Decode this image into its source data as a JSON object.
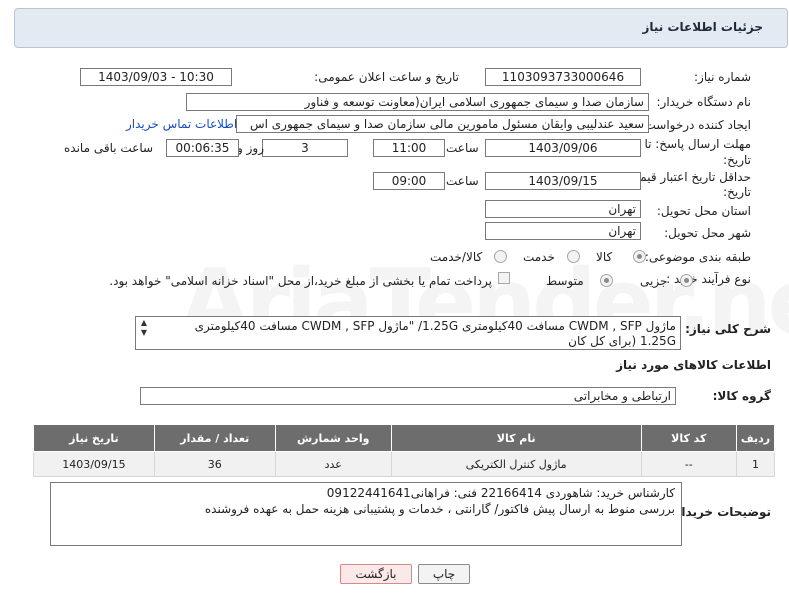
{
  "header": {
    "title": "جزئیات اطلاعات نیاز"
  },
  "fields": {
    "need_number_label": "شماره نیاز:",
    "need_number": "1103093733000646",
    "announce_label": "تاریخ و ساعت اعلان عمومی:",
    "announce_value": "1403/09/03 - 10:30",
    "buyer_org_label": "نام دستگاه خریدار:",
    "buyer_org": "سازمان صدا و سیمای جمهوری اسلامی ایران(معاونت توسعه و فناور",
    "creator_label": "ایجاد کننده درخواست:",
    "creator": "سعید عندلیبی وایقان مسئول مامورین مالی  سازمان صدا و سیمای جمهوری اس",
    "contact_link": "اطلاعات تماس خریدار",
    "deadline_label_1": "مهلت ارسال پاسخ: تا",
    "deadline_label_2": "تاریخ:",
    "deadline_date": "1403/09/06",
    "time_label": "ساعت",
    "deadline_time": "11:00",
    "days_value": "3",
    "days_label": "روز و",
    "remaining_time": "00:06:35",
    "remaining_label": "ساعت باقی مانده",
    "validity_label_1": "حداقل تاریخ اعتبار قیمت: تا",
    "validity_label_2": "تاریخ:",
    "validity_date": "1403/09/15",
    "validity_time": "09:00",
    "province_label": "استان محل تحویل:",
    "province": "تهران",
    "city_label": "شهر محل تحویل:",
    "city": "تهران",
    "category_label": "طبقه بندی موضوعی:",
    "category_options": [
      "کالا",
      "خدمت",
      "کالا/خدمت"
    ],
    "process_label": "نوع فرآیند خرید :",
    "process_options": [
      "جزیی",
      "متوسط"
    ],
    "payment_note": "پرداخت تمام یا بخشی از مبلغ خرید،از محل \"اسناد خزانه اسلامی\" خواهد بود."
  },
  "description": {
    "label": "شرح کلی نیاز:",
    "text": "ماژول CWDM , SFP مسافت 40کیلومتری 1.25G/ \"ماژول CWDM , SFP مسافت 40کیلومتری 1.25G (برای کل کان"
  },
  "goods_section": {
    "title": "اطلاعات کالاهای مورد نیاز",
    "group_label": "گروه کالا:",
    "group_value": "ارتباطی و مخابراتی"
  },
  "table": {
    "headers": [
      "ردیف",
      "کد کالا",
      "نام کالا",
      "واحد شمارش",
      "تعداد / مقدار",
      "تاریخ نیاز"
    ],
    "rows": [
      [
        "1",
        "--",
        "ماژول کنترل الکتریکی",
        "عدد",
        "36",
        "1403/09/15"
      ]
    ]
  },
  "buyer_notes": {
    "label": "توضیحات خریدار:",
    "line1": "کارشناس خرید: شاهوردی 22166414  فنی: فراهانی09122441641",
    "line2": "بررسی منوط به ارسال پیش فاکتور/ گارانتی ، خدمات و پشتیبانی هزینه حمل به عهده فروشنده"
  },
  "buttons": {
    "print": "چاپ",
    "back": "بازگشت"
  },
  "watermark": "AriaTender.net"
}
